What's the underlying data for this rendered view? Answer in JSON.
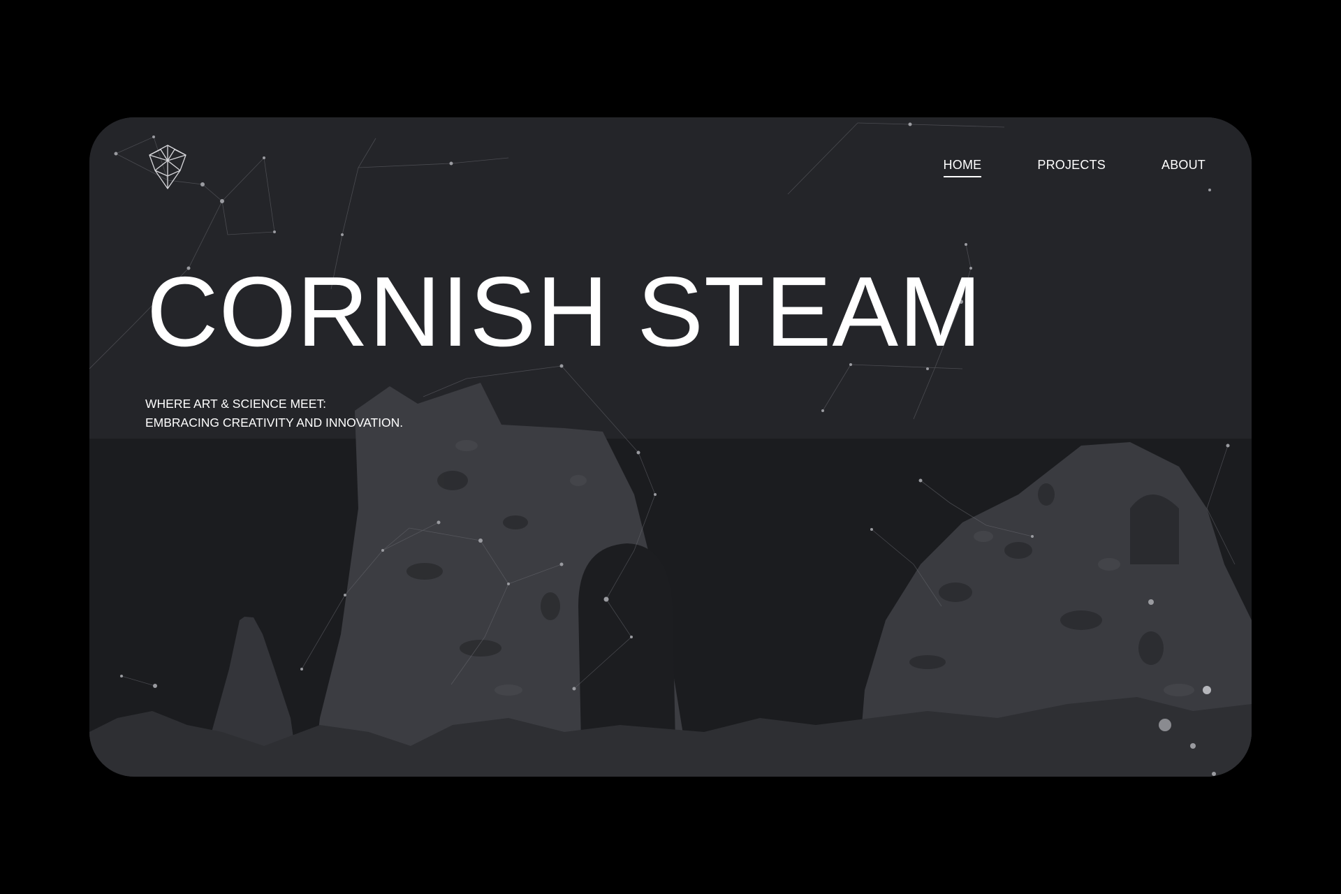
{
  "site": {
    "logo_icon": "geodesic-diamond-icon"
  },
  "nav": {
    "items": [
      {
        "label": "HOME",
        "active": true
      },
      {
        "label": "PROJECTS",
        "active": false
      },
      {
        "label": "ABOUT",
        "active": false
      }
    ]
  },
  "hero": {
    "title": "CORNISH STEAM",
    "tagline_line1": "WHERE ART & SCIENCE MEET:",
    "tagline_line2": "EMBRACING CREATIVITY AND INNOVATION."
  },
  "colors": {
    "page_background": "#000000",
    "hero_sky": "#232428",
    "hero_ground": "#1b1c1f",
    "ruin_stone": "#3a3b40",
    "text": "#ffffff"
  }
}
